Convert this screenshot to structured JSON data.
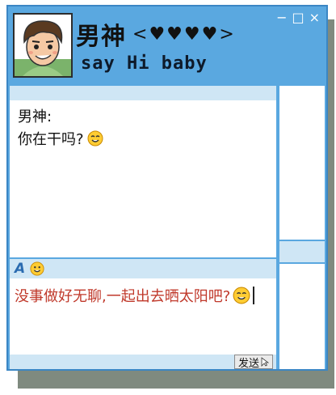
{
  "header": {
    "title": "男神",
    "status": "say Hi baby",
    "decoration_left": "<",
    "decoration_right": ">",
    "heart_count": 4
  },
  "window_controls": {
    "minimize": "−",
    "maximize": "□",
    "close": "×"
  },
  "chat": {
    "sender": "男神:",
    "message": "你在干吗?"
  },
  "input_toolbar": {
    "font_button": "A"
  },
  "input": {
    "text": "没事做好无聊,一起出去晒太阳吧?"
  },
  "send": {
    "label": "发送"
  },
  "colors": {
    "window_blue": "#5aa8e0",
    "strip_blue": "#cfe6f5",
    "input_text": "#c0392b"
  }
}
